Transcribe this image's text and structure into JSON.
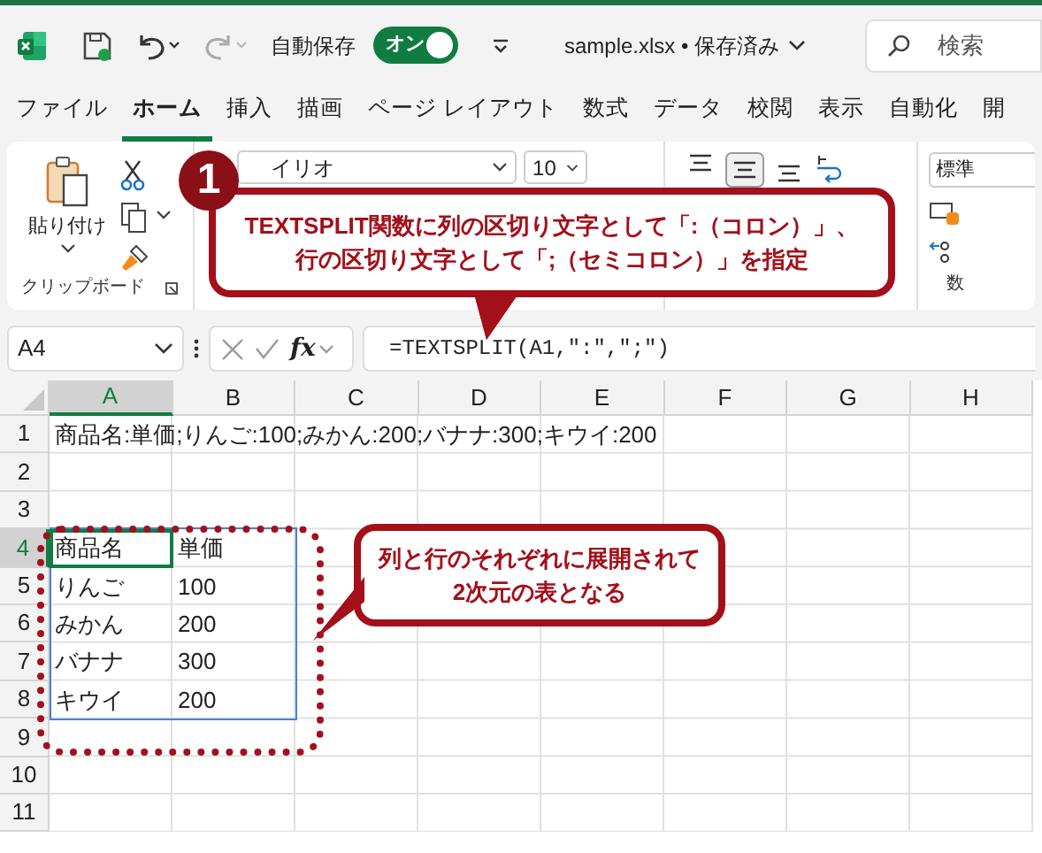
{
  "title_bar": {
    "autosave_label": "自動保存",
    "autosave_toggle": {
      "label": "オン",
      "on": true
    },
    "filename": "sample.xlsx • 保存済み",
    "search": {
      "placeholder": "検索"
    }
  },
  "menu_tabs": [
    {
      "label": "ファイル",
      "selected": false
    },
    {
      "label": "ホーム",
      "selected": true
    },
    {
      "label": "挿入",
      "selected": false
    },
    {
      "label": "描画",
      "selected": false
    },
    {
      "label": "ページ レイアウト",
      "selected": false
    },
    {
      "label": "数式",
      "selected": false
    },
    {
      "label": "データ",
      "selected": false
    },
    {
      "label": "校閲",
      "selected": false
    },
    {
      "label": "表示",
      "selected": false
    },
    {
      "label": "自動化",
      "selected": false
    },
    {
      "label": "開",
      "selected": false
    }
  ],
  "ribbon": {
    "paste_label": "貼り付け",
    "clipboard_group": "クリップボード",
    "font_name": "イリオ",
    "font_size": "10",
    "number_format": "標準",
    "number_group": "数"
  },
  "formula_bar": {
    "name_box": "A4",
    "fx": "fx",
    "formula": "=TEXTSPLIT(A1,\":\",\";\")"
  },
  "sheet": {
    "columns": [
      {
        "label": "A",
        "selected": true
      },
      {
        "label": "B",
        "selected": false
      },
      {
        "label": "C",
        "selected": false
      },
      {
        "label": "D",
        "selected": false
      },
      {
        "label": "E",
        "selected": false
      },
      {
        "label": "F",
        "selected": false
      },
      {
        "label": "G",
        "selected": false
      },
      {
        "label": "H",
        "selected": false
      }
    ],
    "rows": [
      {
        "header": "1",
        "selected": false,
        "cells": [
          {
            "text": "商品名:単価;りんご:100;みかん:200;バナナ:300;キウイ:200",
            "active": false,
            "spill": false
          }
        ]
      },
      {
        "header": "2",
        "selected": false,
        "cells": []
      },
      {
        "header": "3",
        "selected": false,
        "cells": []
      },
      {
        "header": "4",
        "selected": true,
        "cells": [
          {
            "text": "商品名",
            "active": true,
            "spill": true
          },
          {
            "text": "単価",
            "active": false,
            "spill": true
          }
        ]
      },
      {
        "header": "5",
        "selected": false,
        "cells": [
          {
            "text": "りんご",
            "active": false,
            "spill": true
          },
          {
            "text": "100",
            "active": false,
            "spill": true
          }
        ]
      },
      {
        "header": "6",
        "selected": false,
        "cells": [
          {
            "text": "みかん",
            "active": false,
            "spill": true
          },
          {
            "text": "200",
            "active": false,
            "spill": true
          }
        ]
      },
      {
        "header": "7",
        "selected": false,
        "cells": [
          {
            "text": "バナナ",
            "active": false,
            "spill": true
          },
          {
            "text": "300",
            "active": false,
            "spill": true
          }
        ]
      },
      {
        "header": "8",
        "selected": false,
        "cells": [
          {
            "text": "キウイ",
            "active": false,
            "spill": true
          },
          {
            "text": "200",
            "active": false,
            "spill": true
          }
        ]
      },
      {
        "header": "9",
        "selected": false,
        "cells": []
      },
      {
        "header": "10",
        "selected": false,
        "cells": []
      },
      {
        "header": "11",
        "selected": false,
        "cells": []
      }
    ]
  },
  "callouts": [
    {
      "number": "1",
      "lines": [
        "TEXTSPLIT関数に列の区切り文字として「:（コロン）」、",
        "行の区切り文字として「;（セミコロン）」を指定"
      ]
    },
    {
      "lines": [
        "列と行のそれぞれに展開されて",
        "2次元の表となる"
      ]
    }
  ]
}
